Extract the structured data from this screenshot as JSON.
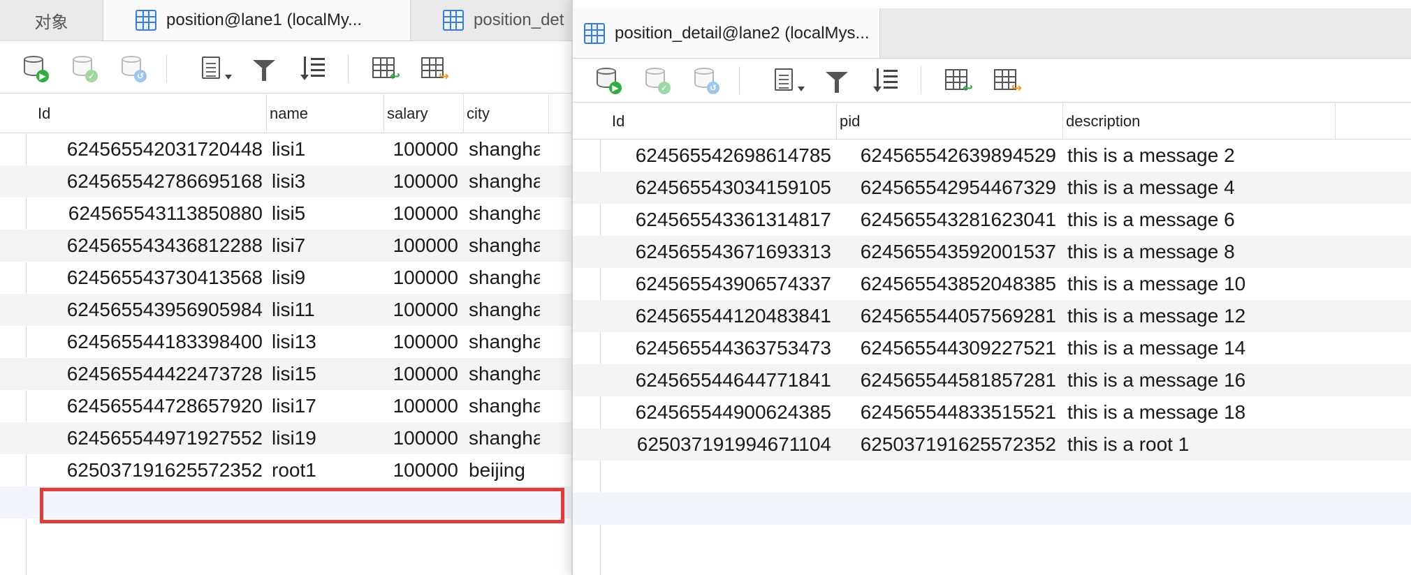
{
  "left_window": {
    "tabs": [
      {
        "label": "对象",
        "icon": null
      },
      {
        "label": "position@lane1 (localMy...",
        "icon": "table-icon"
      },
      {
        "label": "position_det",
        "icon": "table-icon"
      }
    ],
    "columns": [
      "Id",
      "name",
      "salary",
      "city"
    ],
    "rows": [
      {
        "id": "624565542031720448",
        "name": "lisi1",
        "salary": "100000",
        "city": "shangha"
      },
      {
        "id": "624565542786695168",
        "name": "lisi3",
        "salary": "100000",
        "city": "shangha"
      },
      {
        "id": "624565543113850880",
        "name": "lisi5",
        "salary": "100000",
        "city": "shangha"
      },
      {
        "id": "624565543436812288",
        "name": "lisi7",
        "salary": "100000",
        "city": "shangha"
      },
      {
        "id": "624565543730413568",
        "name": "lisi9",
        "salary": "100000",
        "city": "shangha"
      },
      {
        "id": "624565543956905984",
        "name": "lisi11",
        "salary": "100000",
        "city": "shangha"
      },
      {
        "id": "624565544183398400",
        "name": "lisi13",
        "salary": "100000",
        "city": "shangha"
      },
      {
        "id": "624565544422473728",
        "name": "lisi15",
        "salary": "100000",
        "city": "shangha"
      },
      {
        "id": "624565544728657920",
        "name": "lisi17",
        "salary": "100000",
        "city": "shangha"
      },
      {
        "id": "624565544971927552",
        "name": "lisi19",
        "salary": "100000",
        "city": "shangha"
      },
      {
        "id": "625037191625572352",
        "name": "root1",
        "salary": "100000",
        "city": "beijing"
      }
    ]
  },
  "right_window": {
    "tabs": [
      {
        "label": "position_detail@lane2 (localMys...",
        "icon": "table-icon"
      }
    ],
    "columns": [
      "Id",
      "pid",
      "description"
    ],
    "rows": [
      {
        "id": "624565542698614785",
        "pid": "624565542639894529",
        "description": "this is a message 2"
      },
      {
        "id": "624565543034159105",
        "pid": "624565542954467329",
        "description": "this is a message 4"
      },
      {
        "id": "624565543361314817",
        "pid": "624565543281623041",
        "description": "this is a message 6"
      },
      {
        "id": "624565543671693313",
        "pid": "624565543592001537",
        "description": "this is a message 8"
      },
      {
        "id": "624565543906574337",
        "pid": "624565543852048385",
        "description": "this is a message 10"
      },
      {
        "id": "624565544120483841",
        "pid": "624565544057569281",
        "description": "this is a message 12"
      },
      {
        "id": "624565544363753473",
        "pid": "624565544309227521",
        "description": "this is a message 14"
      },
      {
        "id": "624565544644771841",
        "pid": "624565544581857281",
        "description": "this is a message 16"
      },
      {
        "id": "624565544900624385",
        "pid": "624565544833515521",
        "description": "this is a message 18"
      },
      {
        "id": "625037191994671104",
        "pid": "625037191625572352",
        "description": "this is a root 1"
      }
    ]
  },
  "toolbar_icons": [
    "begin-transaction-icon",
    "commit-icon",
    "rollback-icon",
    "text-view-icon",
    "filter-icon",
    "sort-icon",
    "import-icon",
    "export-icon"
  ],
  "colors": {
    "highlight_border": "#e53935",
    "accent_blue": "#3a7bd5",
    "alt_row": "#f4f4f6"
  }
}
